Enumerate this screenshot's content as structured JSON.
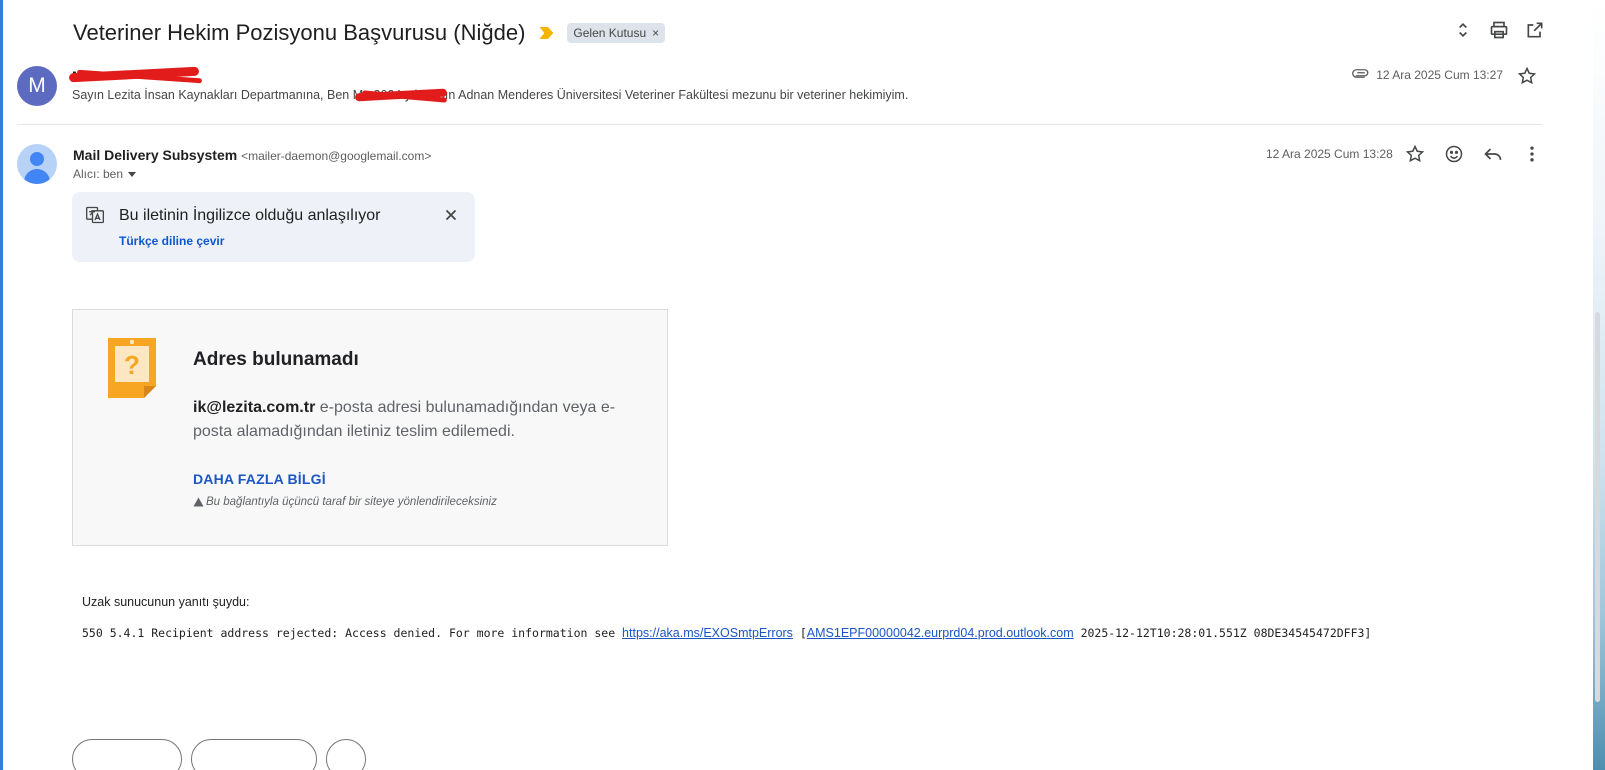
{
  "header": {
    "subject": "Veteriner Hekim Pozisyonu Başvurusu (Niğde)",
    "label": "Gelen Kutusu",
    "label_remove": "×"
  },
  "message1": {
    "avatar_letter": "M",
    "sender": "M",
    "snippet": "Sayın Lezita İnsan Kaynakları Departmanına, Ben M . 2024 yılı Aydın Adnan Menderes Üniversitesi Veteriner Fakültesi mezunu bir veteriner hekimiyim.",
    "date": "12 Ara 2025 Cum 13:27"
  },
  "message2": {
    "sender_name": "Mail Delivery Subsystem",
    "sender_email": "<mailer-daemon@googlemail.com>",
    "to_label": "Alıcı: ben",
    "date": "12 Ara 2025 Cum 13:28"
  },
  "translate_banner": {
    "message": "Bu iletinin İngilizce olduğu anlaşılıyor",
    "action": "Türkçe diline çevir"
  },
  "bounce": {
    "title": "Adres bulunamadı",
    "address": "ik@lezita.com.tr",
    "body": " e-posta adresi bulunamadığından veya e-posta alamadığından iletiniz teslim edilemedi.",
    "more_info": "DAHA FAZLA BİLGİ",
    "warning": "Bu bağlantıyla üçüncü taraf bir siteye yönlendirileceksiniz"
  },
  "remote": {
    "label": "Uzak sunucunun yanıtı şuydu:",
    "prefix": "550 5.4.1 Recipient address rejected: Access denied. For more information see ",
    "link1": "https://aka.ms/EXOSmtpErrors",
    "bracket_open": " [",
    "link2": "AMS1EPF00000042.eurprd04.prod.outlook.com",
    "suffix": " 2025-12-12T10:28:01.551Z 08DE34545472DFF3]"
  },
  "colors": {
    "accent": "#0b57d0",
    "importance": "#f4b400",
    "avatar_m": "#5c6bc0",
    "redaction": "#e21b1b",
    "sticky_note": "#f6a623"
  },
  "icons": [
    "expand-icon",
    "print-icon",
    "open-new-window-icon",
    "attachment-icon",
    "star-icon",
    "emoji-icon",
    "reply-icon",
    "more-vert-icon",
    "translate-icon",
    "close-icon",
    "warning-icon"
  ]
}
